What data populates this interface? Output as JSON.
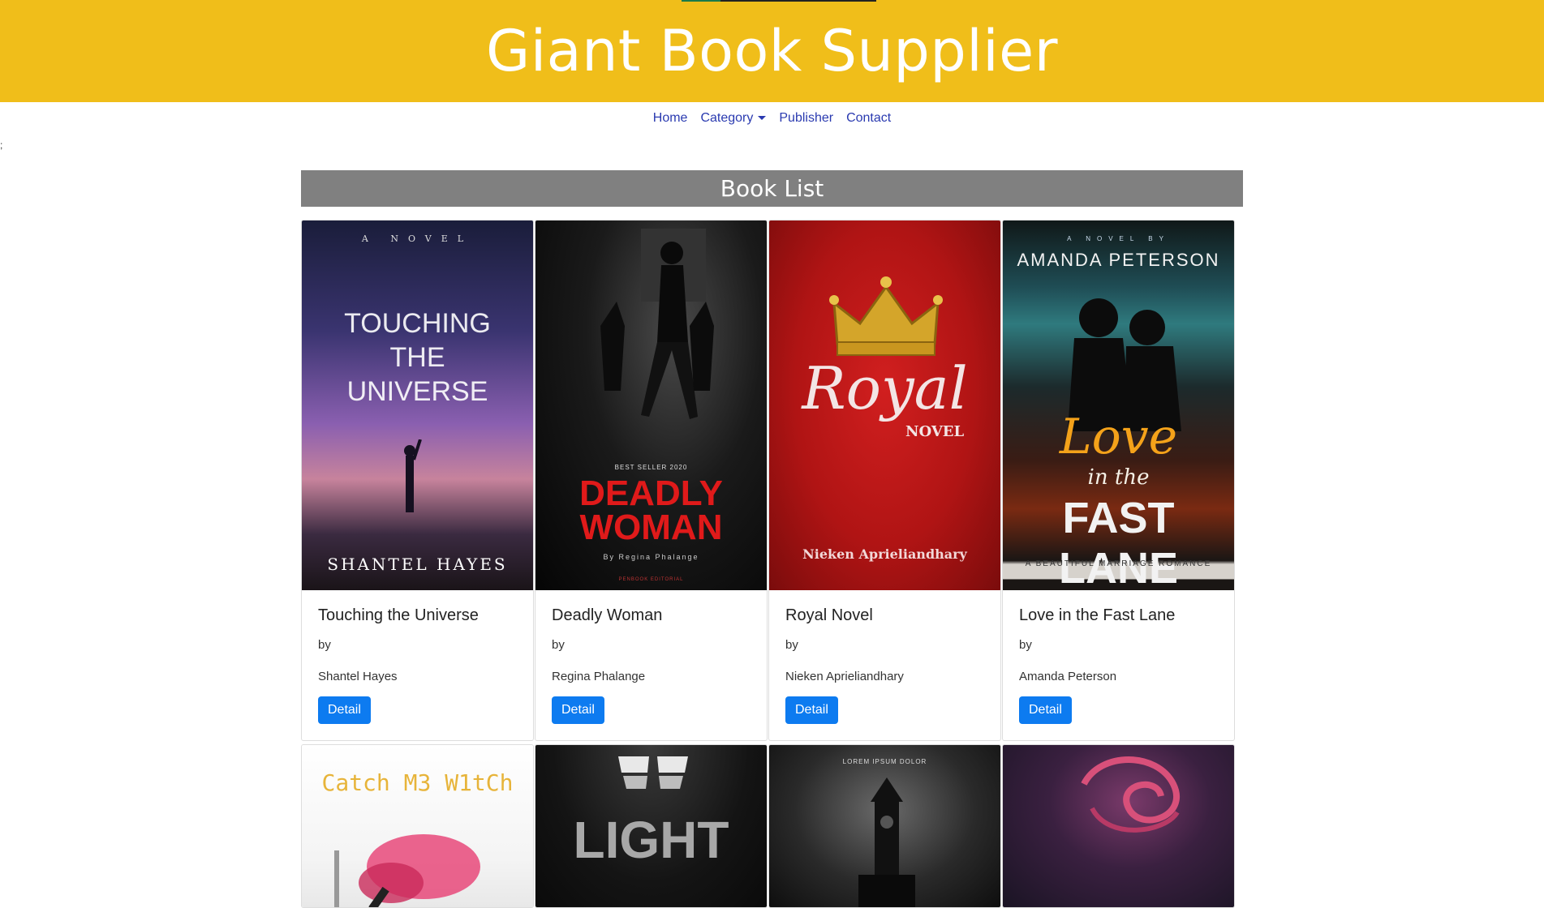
{
  "header": {
    "title": "Giant Book Supplier"
  },
  "nav": {
    "home": "Home",
    "category": "Category",
    "publisher": "Publisher",
    "contact": "Contact"
  },
  "stray_text": ";",
  "section_title": "Book List",
  "books": [
    {
      "title": "Touching the Universe",
      "by": "by",
      "author": "Shantel Hayes",
      "detail": "Detail",
      "cover": {
        "top_text": "A NOVEL",
        "title_line1": "TOUCHING",
        "title_line2": "THE",
        "title_line3": "UNIVERSE",
        "author_text": "SHANTEL HAYES"
      }
    },
    {
      "title": "Deadly Woman",
      "by": "by",
      "author": "Regina Phalange",
      "detail": "Detail",
      "cover": {
        "badge": "BEST SELLER 2020",
        "title_line1": "DEADLY",
        "title_line2": "WOMAN",
        "byline": "By Regina Phalange",
        "imprint": "PENBOOK EDITORIAL"
      }
    },
    {
      "title": "Royal Novel",
      "by": "by",
      "author": "Nieken Aprieliandhary",
      "detail": "Detail",
      "cover": {
        "title_script": "Royal",
        "subtitle": "NOVEL",
        "author_text": "Nieken Aprieliandhary"
      }
    },
    {
      "title": "Love in the Fast Lane",
      "by": "by",
      "author": "Amanda Peterson",
      "detail": "Detail",
      "cover": {
        "top_text": "A NOVEL BY",
        "author_text": "AMANDA PETERSON",
        "title_script": "Love",
        "title_mid": "in the",
        "title_block": "FAST LANE",
        "tagline": "A BEAUTIFUL MARRIAGE ROMANCE"
      }
    }
  ],
  "books_row2": [
    {
      "cover": {
        "title": "Catch M3 W1tCh"
      }
    },
    {
      "cover": {
        "title": "LIGHT"
      }
    },
    {
      "cover": {
        "top_text": "LOREM IPSUM DOLOR"
      }
    },
    {
      "cover": {}
    }
  ]
}
